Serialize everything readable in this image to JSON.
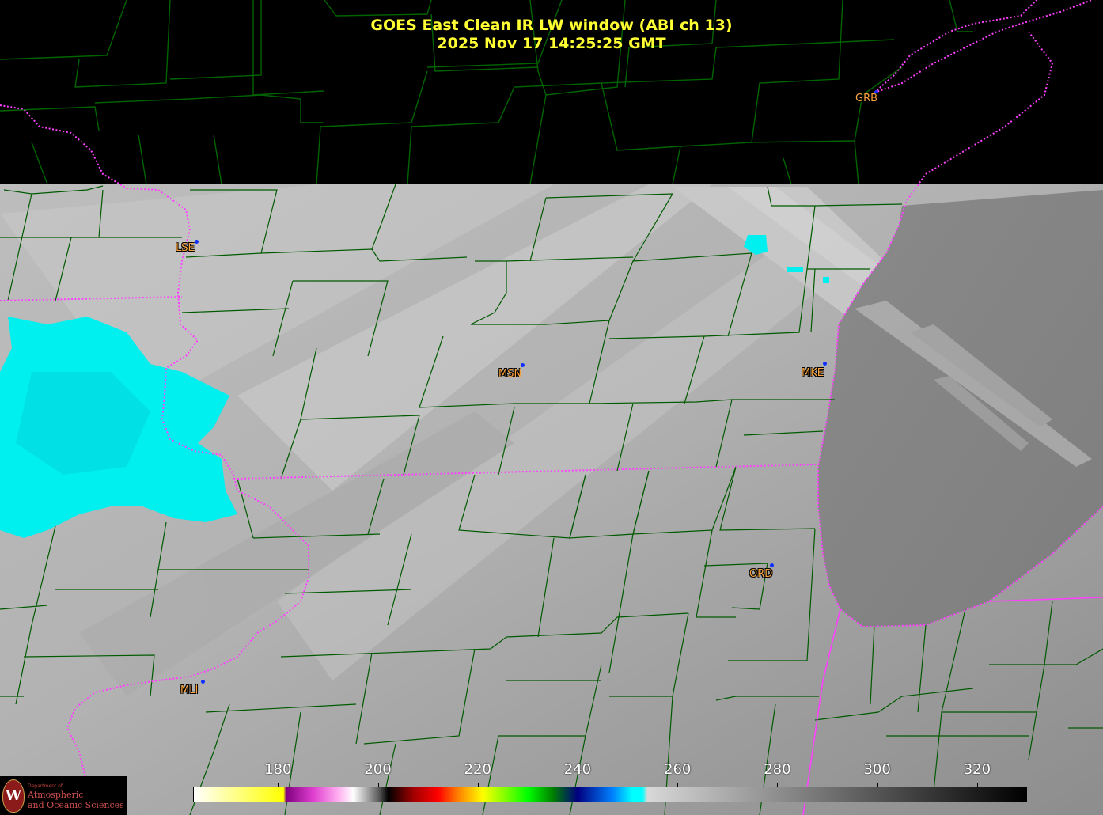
{
  "title": {
    "line1": "GOES East Clean IR LW window (ABI ch 13)",
    "line2": "2025 Nov 17  14:25:25 GMT",
    "color": "#ffff33"
  },
  "stations": [
    {
      "id": "GRB",
      "name": "station-grb"
    },
    {
      "id": "LSE",
      "name": "station-lse"
    },
    {
      "id": "MSN",
      "name": "station-msn"
    },
    {
      "id": "MKE",
      "name": "station-mke"
    },
    {
      "id": "ORD",
      "name": "station-ord"
    },
    {
      "id": "MLI",
      "name": "station-mli"
    }
  ],
  "colorbar": {
    "ticks": [
      "180",
      "200",
      "220",
      "240",
      "260",
      "280",
      "300",
      "320"
    ],
    "stops": [
      {
        "value": 163,
        "color": "#ffffff"
      },
      {
        "value": 172,
        "color": "#ffff80"
      },
      {
        "value": 181,
        "color": "#ffff00"
      },
      {
        "value": 181.5,
        "color": "#800080"
      },
      {
        "value": 187,
        "color": "#e040d0"
      },
      {
        "value": 192,
        "color": "#ffb0f0"
      },
      {
        "value": 195,
        "color": "#ffffff"
      },
      {
        "value": 200,
        "color": "#606060"
      },
      {
        "value": 202,
        "color": "#000000"
      },
      {
        "value": 207,
        "color": "#a00000"
      },
      {
        "value": 212,
        "color": "#ff0000"
      },
      {
        "value": 216,
        "color": "#ff8000"
      },
      {
        "value": 221,
        "color": "#ffff00"
      },
      {
        "value": 230,
        "color": "#00ff00"
      },
      {
        "value": 235,
        "color": "#008000"
      },
      {
        "value": 240,
        "color": "#000080"
      },
      {
        "value": 247,
        "color": "#0080ff"
      },
      {
        "value": 251,
        "color": "#00ffff"
      },
      {
        "value": 253,
        "color": "#00ffff"
      },
      {
        "value": 254,
        "color": "#d8d8d8"
      },
      {
        "value": 330,
        "color": "#000000"
      }
    ]
  },
  "map_colors": {
    "state_border": "#ff40ff",
    "county_line": "#006400",
    "cold_cloud": "#00f0f0",
    "no_data": "#000000"
  },
  "logo": {
    "seal_letter": "W",
    "department": "Department of",
    "line1": "Atmospheric",
    "line2": "and Oceanic Sciences"
  }
}
